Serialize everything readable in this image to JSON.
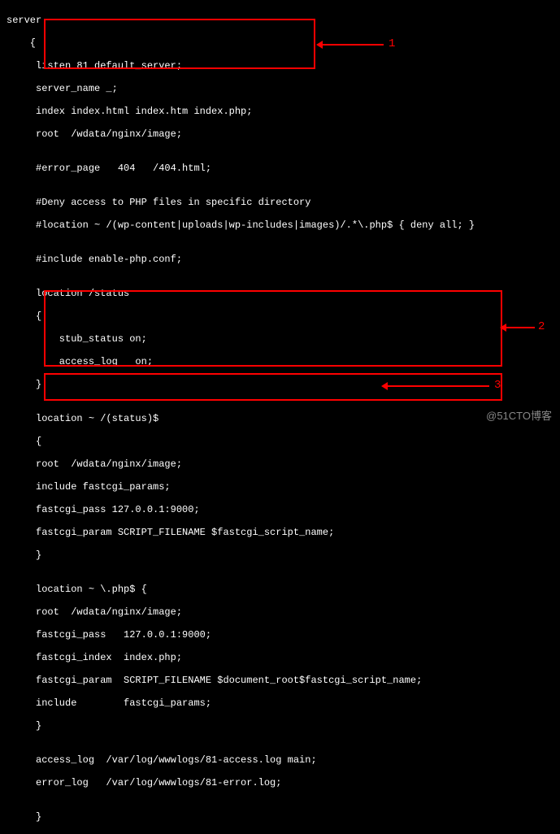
{
  "code": {
    "l01": "server",
    "l02": "    {",
    "l03": "     listen 81 default_server;",
    "l04": "     server_name _;",
    "l05": "     index index.html index.htm index.php;",
    "l06": "     root  /wdata/nginx/image;",
    "l07": "",
    "l08": "     #error_page   404   /404.html;",
    "l09": "",
    "l10": "     #Deny access to PHP files in specific directory",
    "l11": "     #location ~ /(wp-content|uploads|wp-includes|images)/.*\\.php$ { deny all; }",
    "l12": "",
    "l13": "     #include enable-php.conf;",
    "l14": "",
    "l15": "     location /status",
    "l16": "     {",
    "l17": "         stub_status on;",
    "l18": "         access_log   on;",
    "l19": "     }",
    "l20": "",
    "l21": "     location ~ /(status)$",
    "l22": "     {",
    "l23": "     root  /wdata/nginx/image;",
    "l24": "     include fastcgi_params;",
    "l25": "     fastcgi_pass 127.0.0.1:9000;",
    "l26": "     fastcgi_param SCRIPT_FILENAME $fastcgi_script_name;",
    "l27": "     }",
    "l28": "",
    "l29": "     location ~ \\.php$ {",
    "l30": "     root  /wdata/nginx/image;",
    "l31": "     fastcgi_pass   127.0.0.1:9000;",
    "l32": "     fastcgi_index  index.php;",
    "l33": "     fastcgi_param  SCRIPT_FILENAME $document_root$fastcgi_script_name;",
    "l34": "     include        fastcgi_params;",
    "l35": "     }",
    "l36": "",
    "l37": "     access_log  /var/log/wwwlogs/81-access.log main;",
    "l38": "     error_log   /var/log/wwwlogs/81-error.log;",
    "l39": "",
    "l40": "     }"
  },
  "labels": {
    "n1": "1",
    "n2": "2",
    "n3": "3"
  },
  "watermark": "@51CTO博客"
}
